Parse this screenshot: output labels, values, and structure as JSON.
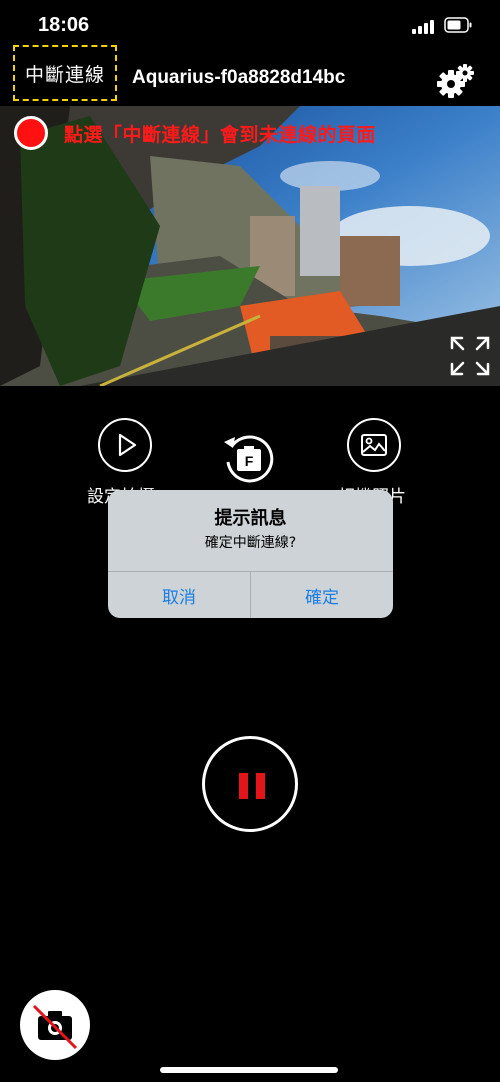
{
  "status": {
    "time": "18:06"
  },
  "header": {
    "disconnect_label": "中斷連線",
    "device_name": "Aquarius-f0a8828d14bc"
  },
  "hint": {
    "text": "點選「中斷連線」會到未連線的頁面"
  },
  "controls": {
    "left_label": "設定拍攝",
    "right_label": "相機照片"
  },
  "dialog": {
    "title": "提示訊息",
    "message": "確定中斷連線?",
    "cancel_label": "取消",
    "confirm_label": "確定"
  },
  "icons": {
    "settings": "gear-icon",
    "fullscreen": "expand-icon",
    "play": "play-icon",
    "flip": "rotate-camera-icon",
    "photos": "image-icon",
    "record": "pause-icon",
    "camera": "camera-off-icon"
  },
  "colors": {
    "accent_red": "#ff1a1a",
    "dialog_button": "#1b7ee6",
    "highlight": "#f4d400"
  }
}
